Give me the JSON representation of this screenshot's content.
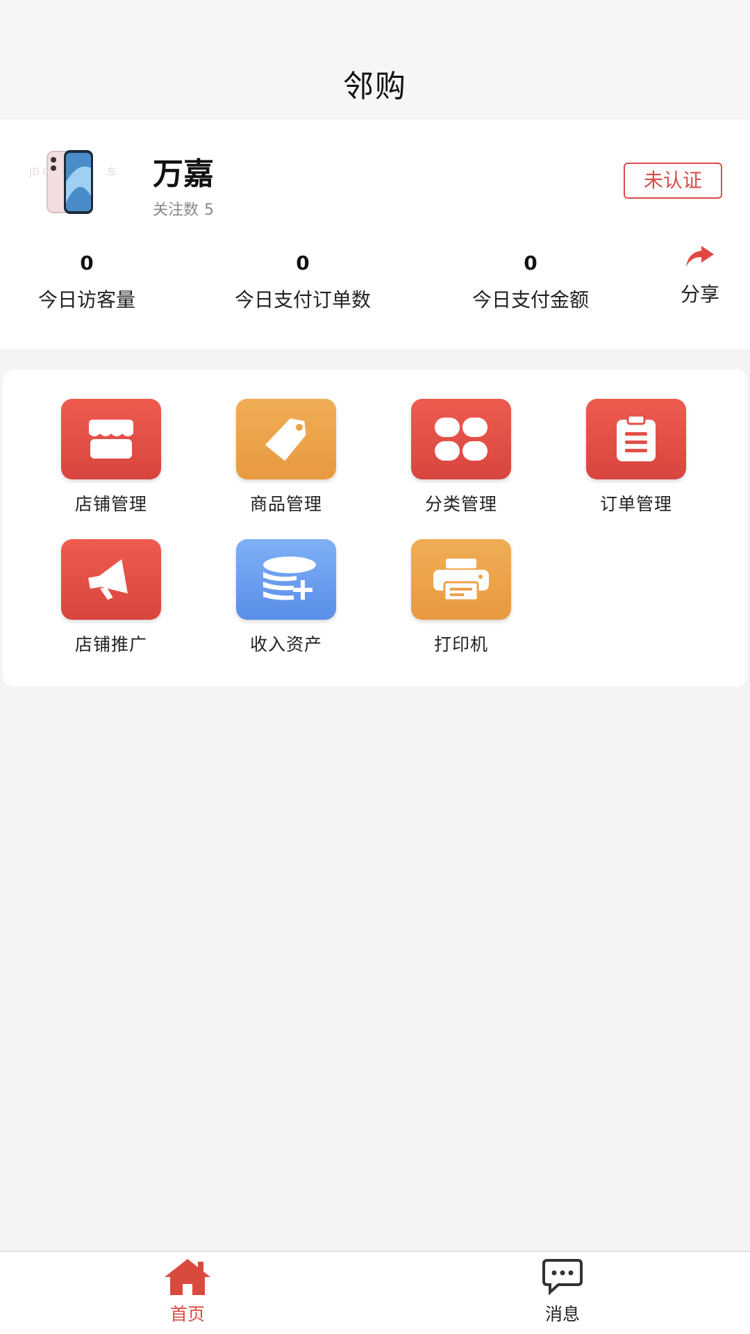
{
  "header": {
    "title": "邻购"
  },
  "store": {
    "name": "万嘉",
    "followers_label": "关注数",
    "followers_count": "5",
    "cert_status": "未认证"
  },
  "stats": [
    {
      "value": "0",
      "label": "今日访客量"
    },
    {
      "value": "0",
      "label": "今日支付订单数"
    },
    {
      "value": "0",
      "label": "今日支付金额"
    }
  ],
  "share": {
    "label": "分享",
    "icon": "share-arrow-icon"
  },
  "menu": {
    "items": [
      {
        "label": "店铺管理",
        "icon": "store-icon",
        "color": "#e24f45"
      },
      {
        "label": "商品管理",
        "icon": "tag-icon",
        "color": "#eca24a"
      },
      {
        "label": "分类管理",
        "icon": "category-grid-icon",
        "color": "#e24f45"
      },
      {
        "label": "订单管理",
        "icon": "clipboard-icon",
        "color": "#e24f45"
      },
      {
        "label": "店铺推广",
        "icon": "megaphone-icon",
        "color": "#e24f45"
      },
      {
        "label": "收入资产",
        "icon": "coins-plus-icon",
        "color": "#6a9cee"
      },
      {
        "label": "打印机",
        "icon": "printer-icon",
        "color": "#eca24a"
      }
    ]
  },
  "tabbar": {
    "tabs": [
      {
        "label": "首页",
        "icon": "home-icon",
        "active": true
      },
      {
        "label": "消息",
        "icon": "message-icon",
        "active": false
      }
    ],
    "active_color": "#d94a3e"
  }
}
